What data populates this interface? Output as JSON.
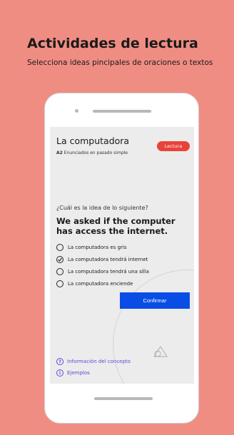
{
  "header": {
    "title": "Actividades de lectura",
    "subtitle": "Selecciona ideas pincipales de oraciones o textos"
  },
  "lesson": {
    "title": "La computadora",
    "level": "A2",
    "level_desc": "Enunciados en pasado simple",
    "badge": "Lectura"
  },
  "exercise": {
    "prompt": "¿Cuál es la idea de lo siguiente?",
    "sentence": "We asked if the computer has access the internet.",
    "options": [
      {
        "label": "La computadora es gris",
        "selected": false
      },
      {
        "label": "La computadora tendrá internet",
        "selected": true
      },
      {
        "label": "La computadora tendrá una silla",
        "selected": false
      },
      {
        "label": "La computadora enciende",
        "selected": false
      }
    ],
    "confirm_label": "Confirmar"
  },
  "links": {
    "concept": {
      "icon": "question-icon",
      "glyph": "?",
      "label": "Información del concepto"
    },
    "examples": {
      "icon": "info-icon",
      "glyph": "i",
      "label": "Ejemplos"
    }
  },
  "colors": {
    "background": "#f08d83",
    "badge": "#e9423b",
    "primary": "#0a4de6",
    "link": "#5c4bd6"
  }
}
